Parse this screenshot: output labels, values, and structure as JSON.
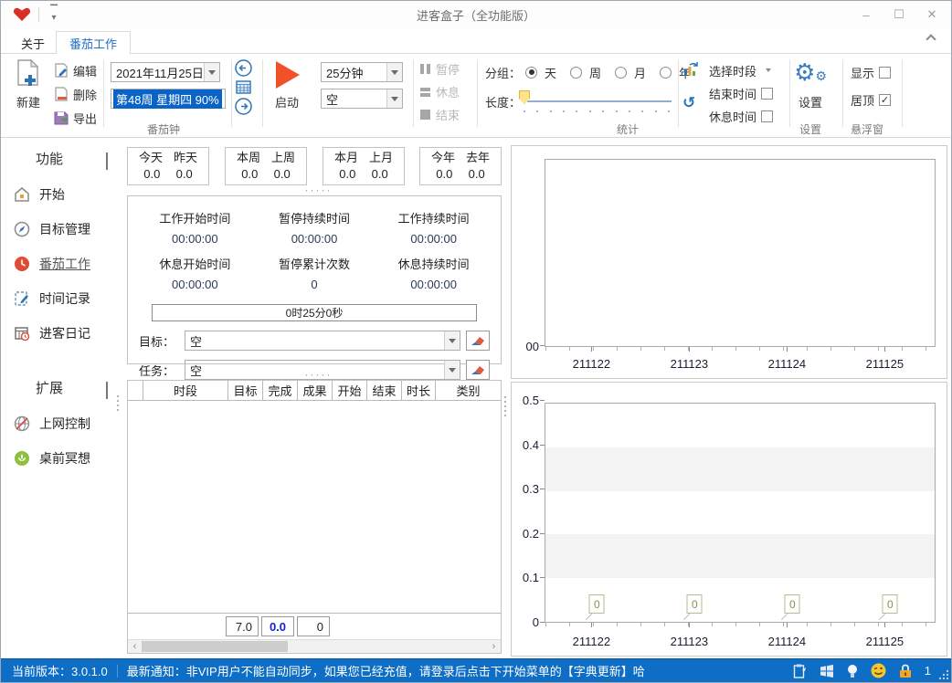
{
  "window": {
    "title": "进客盒子（全功能版）",
    "minimize": "–",
    "maximize": "☐",
    "close": "✕"
  },
  "tabs": {
    "about": "关于",
    "pomodoro": "番茄工作"
  },
  "ribbon": {
    "new_label": "新建",
    "edit_label": "编辑",
    "delete_label": "删除",
    "export_label": "导出",
    "date_value": "2021年11月25日",
    "week_value": "第48周 星期四 90%",
    "start_label": "启动",
    "duration_value": "25分钟",
    "task_combo_value": "空",
    "pause_label": "暂停",
    "rest_label": "休息",
    "end_label": "结束",
    "groupby_label": "分组：",
    "groupby_options": [
      "天",
      "周",
      "月",
      "年"
    ],
    "groupby_selected": "天",
    "length_label": "长度：",
    "select_period_label": "选择时段",
    "end_time_label": "结束时间",
    "rest_time_label": "休息时间",
    "settings_label": "设置",
    "show_label": "显示",
    "topmost_label": "居顶",
    "group_pomodoro": "番茄钟",
    "group_stats": "统计",
    "group_settings": "设置",
    "group_float": "悬浮窗"
  },
  "sidebar": {
    "section1_title": "功能",
    "section2_title": "扩展",
    "items": [
      {
        "label": "开始"
      },
      {
        "label": "目标管理"
      },
      {
        "label": "番茄工作"
      },
      {
        "label": "时间记录"
      },
      {
        "label": "进客日记"
      },
      {
        "label": "上网控制"
      },
      {
        "label": "桌前冥想"
      }
    ]
  },
  "stats_boxes": [
    {
      "label1": "今天",
      "label2": "昨天",
      "value1": "0.0",
      "value2": "0.0"
    },
    {
      "label1": "本周",
      "label2": "上周",
      "value1": "0.0",
      "value2": "0.0"
    },
    {
      "label1": "本月",
      "label2": "上月",
      "value1": "0.0",
      "value2": "0.0"
    },
    {
      "label1": "今年",
      "label2": "去年",
      "value1": "0.0",
      "value2": "0.0"
    }
  ],
  "session": {
    "fields": [
      {
        "label": "工作开始时间",
        "value": "00:00:00"
      },
      {
        "label": "暂停持续时间",
        "value": "00:00:00"
      },
      {
        "label": "工作持续时间",
        "value": "00:00:00"
      },
      {
        "label": "休息开始时间",
        "value": "00:00:00"
      },
      {
        "label": "暂停累计次数",
        "value": "0"
      },
      {
        "label": "休息持续时间",
        "value": "00:00:00"
      }
    ],
    "progress_text": "0时25分0秒",
    "goal_label": "目标：",
    "goal_value": "空",
    "task_label": "任务：",
    "task_value": "空"
  },
  "table": {
    "headers": [
      "",
      "时段",
      "目标",
      "完成",
      "成果",
      "开始",
      "结束",
      "时长",
      "类别"
    ],
    "rows": [],
    "totals": [
      "7.0",
      "0.0",
      "0"
    ]
  },
  "chart_data": [
    {
      "type": "line",
      "title": "",
      "categories": [
        "211122",
        "211123",
        "211124",
        "211125"
      ],
      "series": [],
      "yticks": [
        "00"
      ],
      "xlabel": "",
      "ylabel": "",
      "note": "empty plot, no data drawn"
    },
    {
      "type": "line",
      "title": "",
      "categories": [
        "211122",
        "211123",
        "211124",
        "211125"
      ],
      "series": [
        {
          "name": "",
          "values": [
            0,
            0,
            0,
            0
          ]
        }
      ],
      "point_labels": [
        "0",
        "0",
        "0",
        "0"
      ],
      "ylim": [
        0,
        0.5
      ],
      "yticks": [
        0,
        0.1,
        0.2,
        0.3,
        0.4,
        0.5
      ],
      "bands": [
        [
          0.1,
          0.2
        ],
        [
          0.3,
          0.4
        ]
      ],
      "grid": "alternating horizontal bands"
    }
  ],
  "statusbar": {
    "version": "当前版本：3.0.1.0",
    "notice": "最新通知：非VIP用户不能自动同步，如果您已经充值，请登录后点击下开始菜单的【字典更新】哈",
    "lock_count": "1"
  },
  "colors": {
    "accent_blue": "#1e6ec8",
    "statusbar_blue": "#0e6dc4",
    "play_orange": "#f0512a",
    "selection_blue": "#0a64c8",
    "slider_thumb_yellow": "#ffe389",
    "point_label_olive": "#8a8f52",
    "total_blue": "#1322d2",
    "logo_red": "#d93025"
  }
}
